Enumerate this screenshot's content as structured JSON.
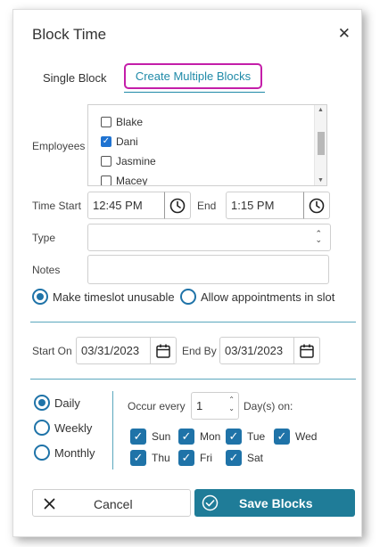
{
  "dialog": {
    "title": "Block Time",
    "close_glyph": "✕",
    "tabs": [
      {
        "label": "Single Block",
        "active": false
      },
      {
        "label": "Create Multiple Blocks",
        "active": true
      }
    ]
  },
  "employees": {
    "label": "Employees",
    "items": [
      {
        "name": "Blake",
        "checked": false
      },
      {
        "name": "Dani",
        "checked": true
      },
      {
        "name": "Jasmine",
        "checked": false
      },
      {
        "name": "Macey",
        "checked": false
      }
    ]
  },
  "time": {
    "start_label": "Time Start",
    "start_value": "12:45 PM",
    "end_label": "End",
    "end_value": "1:15 PM",
    "icon": "clock-icon"
  },
  "type": {
    "label": "Type",
    "value": ""
  },
  "notes": {
    "label": "Notes",
    "value": ""
  },
  "slot_options": [
    {
      "label": "Make timeslot unusable",
      "selected": true
    },
    {
      "label": "Allow appointments in slot",
      "selected": false
    }
  ],
  "dates": {
    "start_label": "Start On",
    "start_value": "03/31/2023",
    "end_label": "End By",
    "end_value": "03/31/2023",
    "icon": "calendar-icon"
  },
  "recurrence": {
    "options": [
      {
        "label": "Daily",
        "selected": true
      },
      {
        "label": "Weekly",
        "selected": false
      },
      {
        "label": "Monthly",
        "selected": false
      }
    ],
    "occur_label": "Occur every",
    "occur_value": "1",
    "days_label": "Day(s) on:",
    "days": [
      {
        "label": "Sun",
        "checked": true
      },
      {
        "label": "Mon",
        "checked": true
      },
      {
        "label": "Tue",
        "checked": true
      },
      {
        "label": "Wed",
        "checked": true
      },
      {
        "label": "Thu",
        "checked": true
      },
      {
        "label": "Fri",
        "checked": true
      },
      {
        "label": "Sat",
        "checked": true
      }
    ]
  },
  "buttons": {
    "cancel": "Cancel",
    "save": "Save Blocks"
  },
  "colors": {
    "accent": "#1f7c98",
    "tab_highlight": "#c41ea9",
    "checkbox_blue": "#1f73d1"
  }
}
